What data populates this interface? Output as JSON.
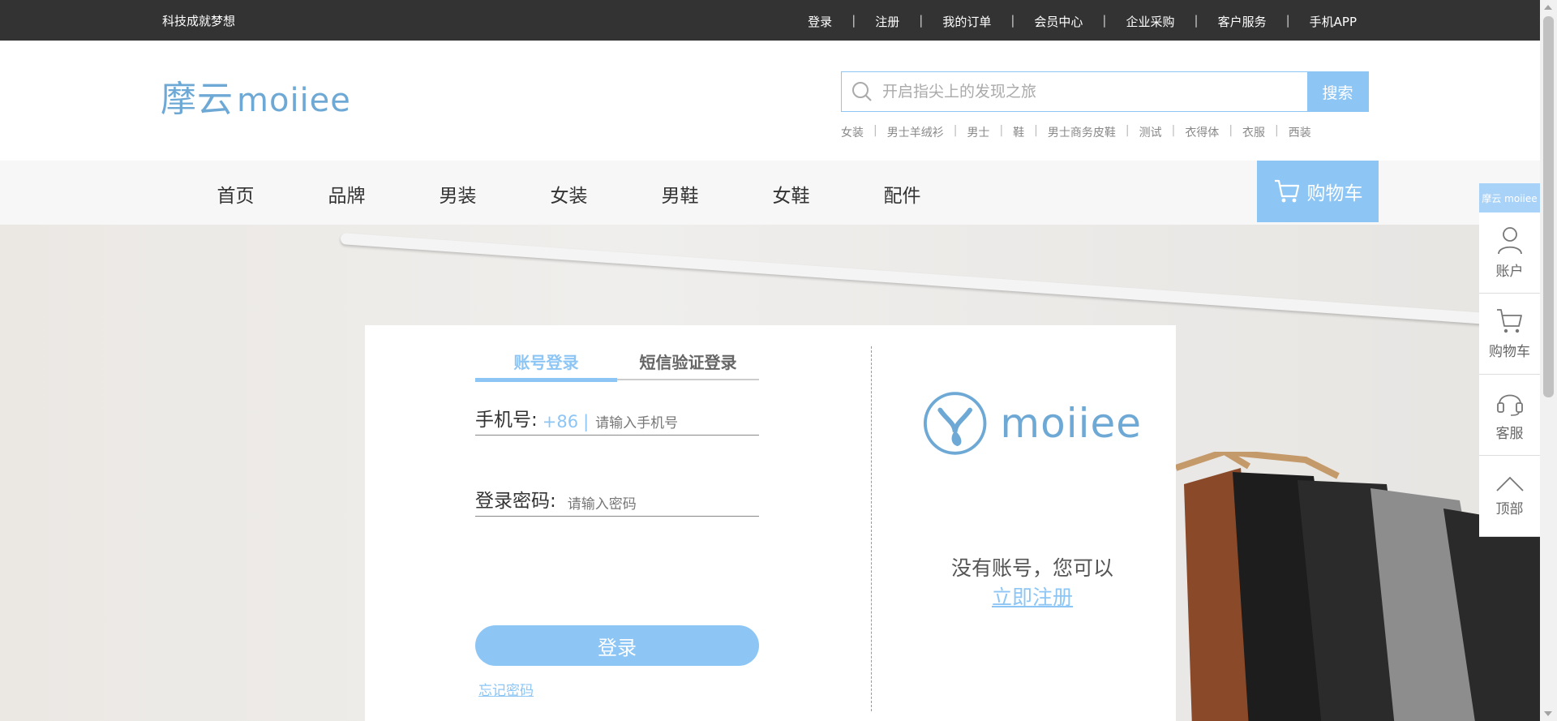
{
  "topbar": {
    "slogan": "科技成就梦想",
    "links": [
      "登录",
      "注册",
      "我的订单",
      "会员中心",
      "企业采购",
      "客户服务",
      "手机APP"
    ]
  },
  "header": {
    "logo_cn": "摩云",
    "logo_en": "moiiee",
    "search_placeholder": "开启指尖上的发现之旅",
    "search_button": "搜索",
    "hot_words": [
      "女装",
      "男士羊绒衫",
      "男士",
      "鞋",
      "男士商务皮鞋",
      "测试",
      "衣得体",
      "衣服",
      "西装"
    ]
  },
  "nav": {
    "items": [
      "首页",
      "品牌",
      "男装",
      "女装",
      "男鞋",
      "女鞋",
      "配件"
    ],
    "cart_label": "购物车"
  },
  "login": {
    "tabs": [
      "账号登录",
      "短信验证登录"
    ],
    "active_tab": 0,
    "phone_label": "手机号:",
    "phone_code": "+86",
    "phone_placeholder": "请输入手机号",
    "password_label": "登录密码:",
    "password_placeholder": "请输入密码",
    "login_button": "登录",
    "forgot_link": "忘记密码",
    "brand_word": "moiiee",
    "no_account_text": "没有账号，您可以",
    "register_link": "立即注册"
  },
  "floatbar": {
    "mini_logo": "摩云 moiiee",
    "items": [
      "账户",
      "购物车",
      "客服",
      "顶部"
    ]
  },
  "colors": {
    "accent": "#8dc6f5",
    "topbar": "#333333",
    "logo": "#6ea9d6"
  }
}
